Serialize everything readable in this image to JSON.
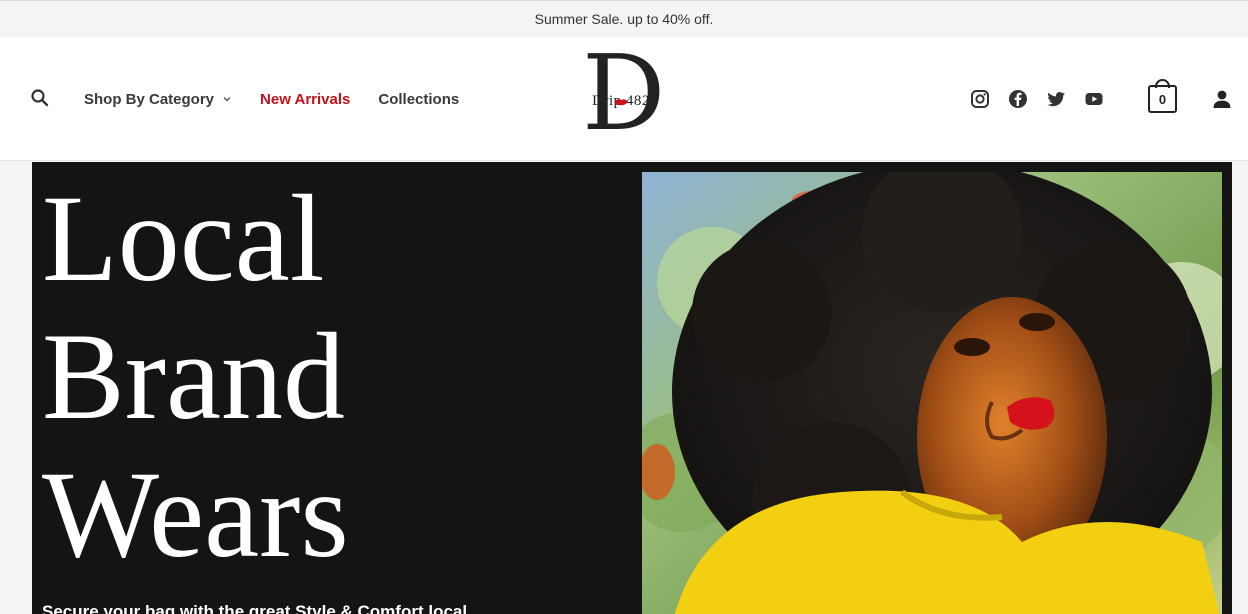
{
  "announcement": {
    "text": "Summer Sale. up to 40% off."
  },
  "brand": {
    "initial": "D",
    "name": "Drip 4820"
  },
  "nav": {
    "items": [
      {
        "label": "Shop By Category",
        "has_dropdown": true,
        "active": false
      },
      {
        "label": "New Arrivals",
        "has_dropdown": false,
        "active": true
      },
      {
        "label": "Collections",
        "has_dropdown": false,
        "active": false
      }
    ]
  },
  "icons": {
    "search": "search-icon",
    "socials": [
      "instagram-icon",
      "facebook-icon",
      "twitter-icon",
      "youtube-icon"
    ],
    "cart": "cart-icon",
    "account": "user-icon"
  },
  "cart": {
    "count": "0"
  },
  "hero": {
    "title": "Local\nBrand\nWears",
    "subtitle": "Secure your bag with the great Style & Comfort local",
    "image": "portrait of a woman with curly hair, red lipstick and yellow top"
  },
  "colors": {
    "accent": "#c8101a",
    "hero_bg": "#141414",
    "topbar_bg": "#f2f5f3",
    "text": "#3a3a3a"
  }
}
